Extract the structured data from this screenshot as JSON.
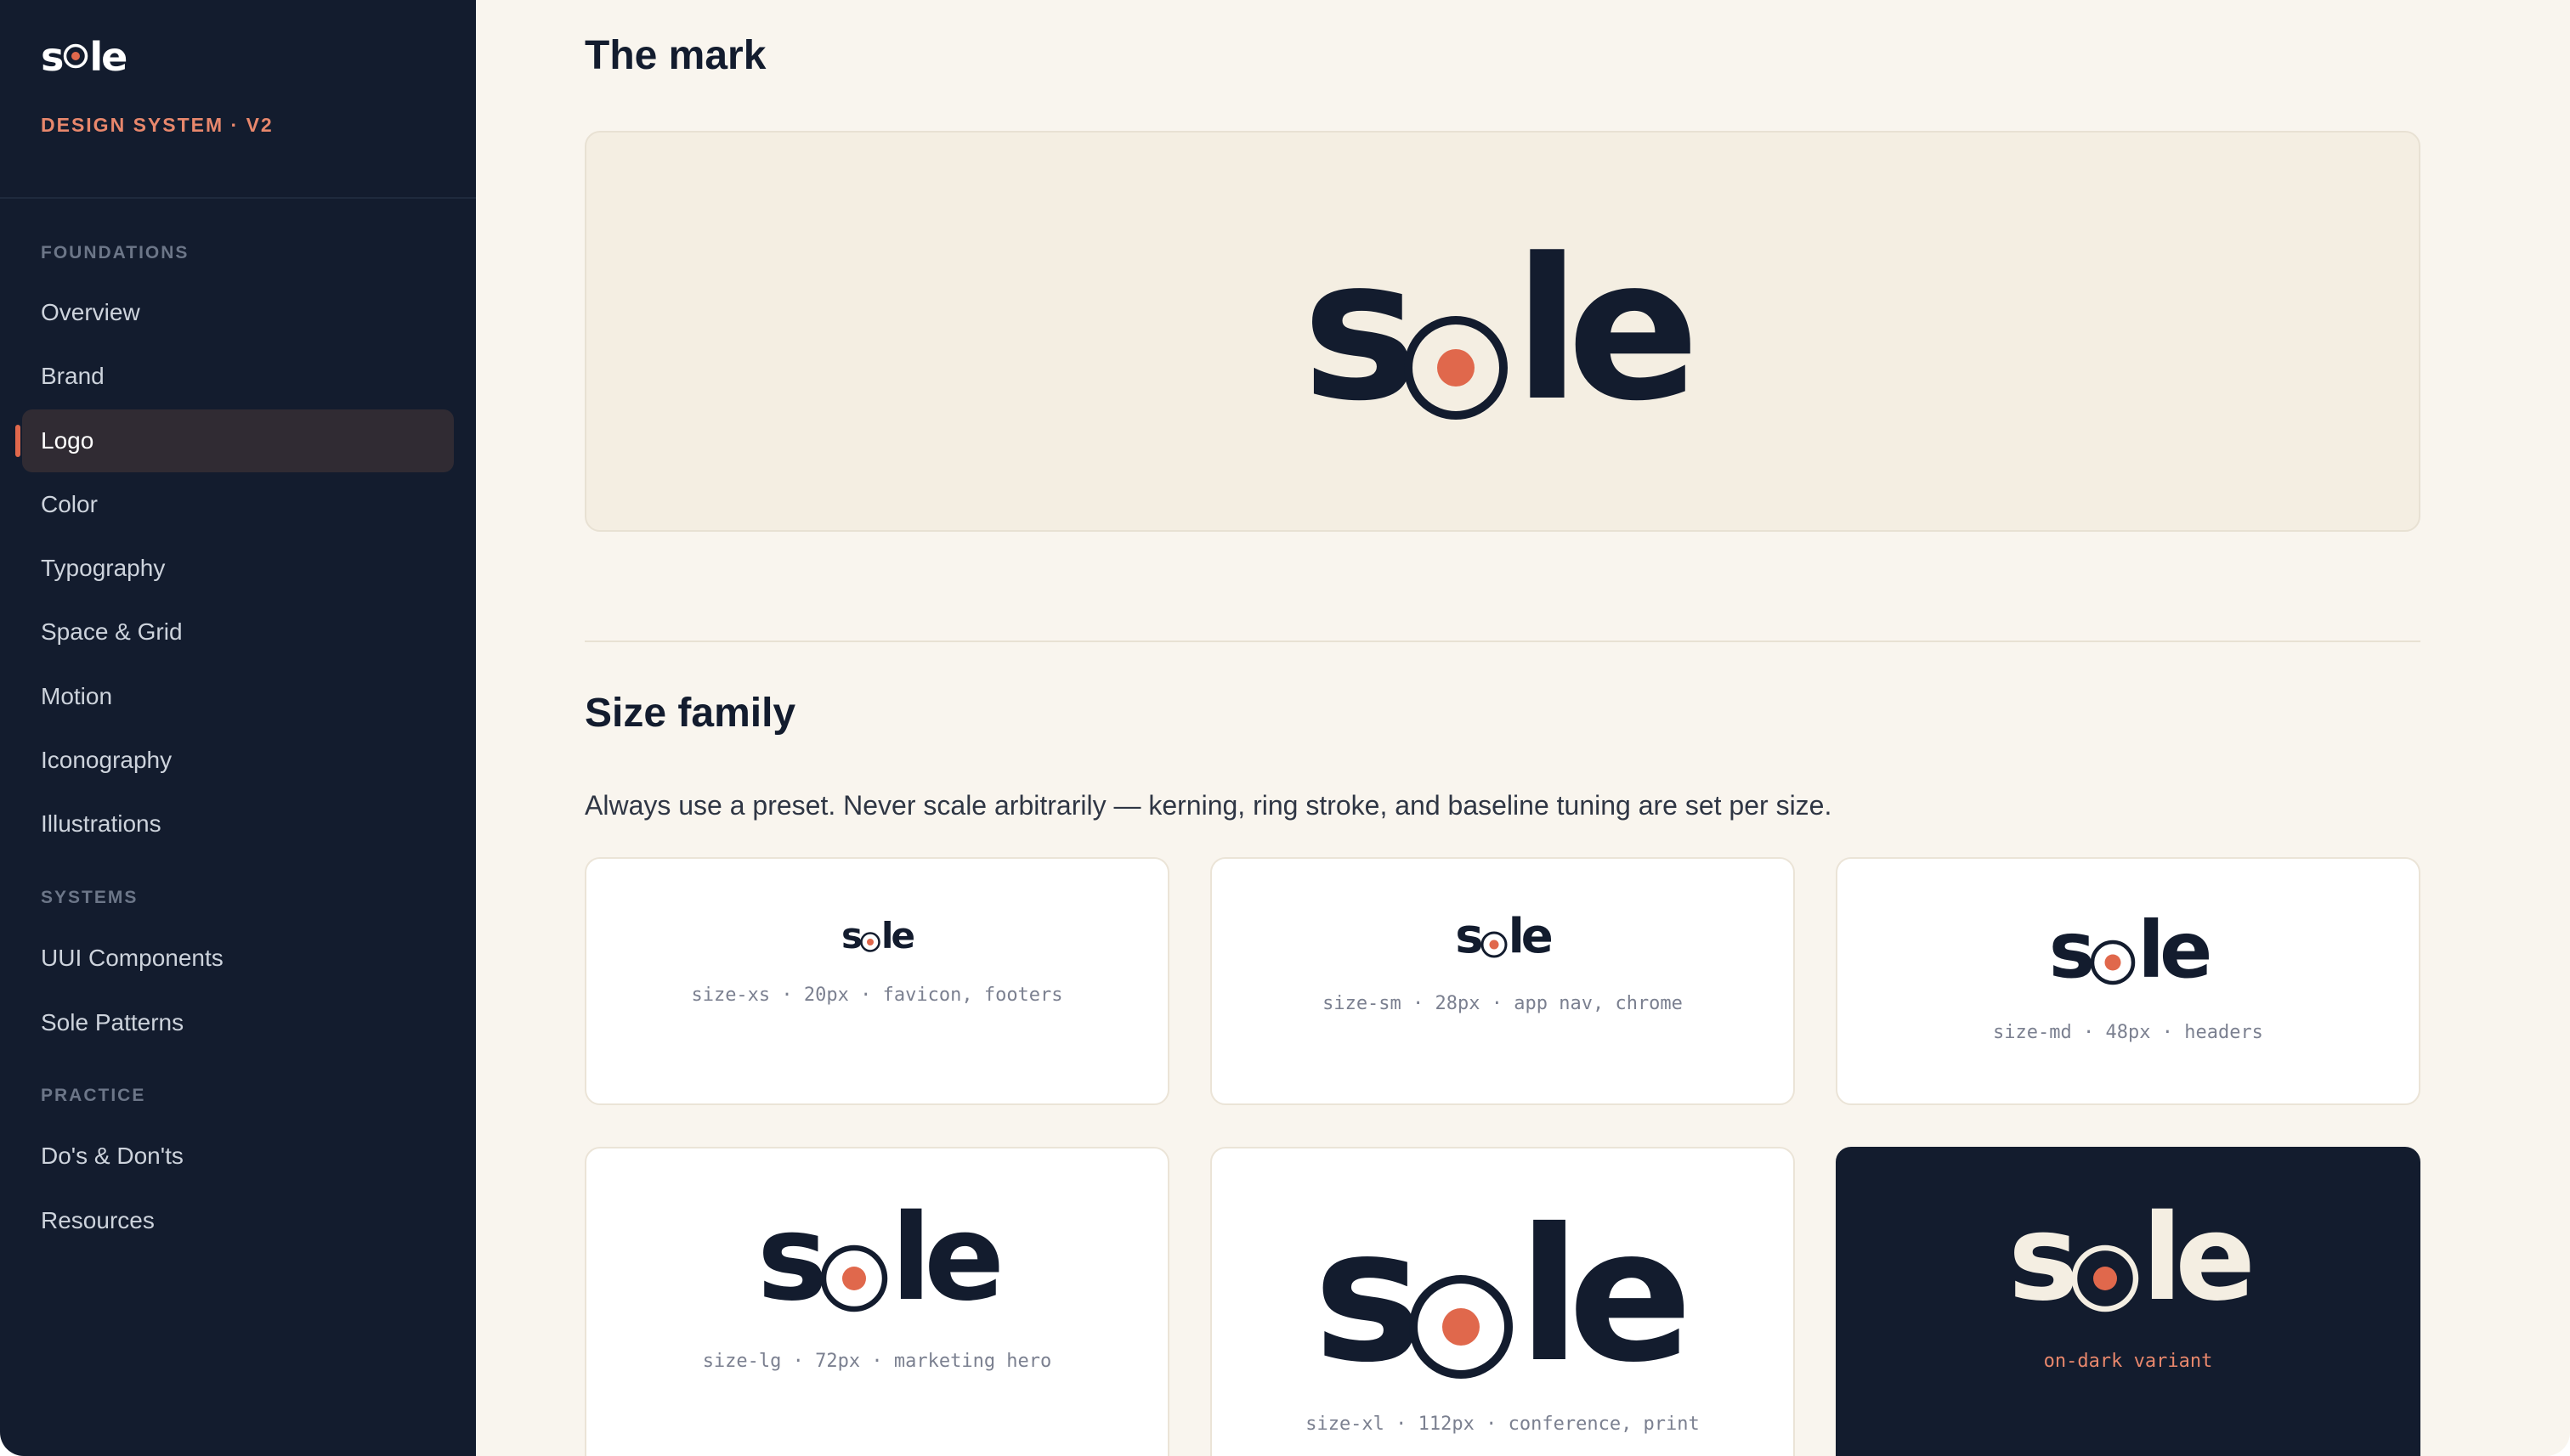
{
  "sidebar": {
    "logo": {
      "s": "s",
      "le": "le"
    },
    "subtitle": "DESIGN SYSTEM · V2",
    "groups": [
      {
        "label": "FOUNDATIONS"
      },
      {
        "label": "SYSTEMS"
      },
      {
        "label": "PRACTICE"
      }
    ],
    "items": [
      {
        "label": "Overview"
      },
      {
        "label": "Brand"
      },
      {
        "label": "Logo",
        "active": true
      },
      {
        "label": "Color"
      },
      {
        "label": "Typography"
      },
      {
        "label": "Space & Grid"
      },
      {
        "label": "Motion"
      },
      {
        "label": "Iconography"
      },
      {
        "label": "Illustrations"
      },
      {
        "label": "UUI Components"
      },
      {
        "label": "Sole Patterns"
      },
      {
        "label": "Do's & Don'ts"
      },
      {
        "label": "Resources"
      }
    ]
  },
  "main": {
    "mark_heading": "The mark",
    "size_heading": "Size family",
    "size_description": "Always use a preset. Never scale arbitrarily — kerning, ring stroke, and baseline tuning are set per size.",
    "wordmark": {
      "s": "s",
      "le": "le"
    },
    "cards": [
      {
        "caption": "size-xs · 20px · favicon, footers"
      },
      {
        "caption": "size-sm · 28px · app nav, chrome"
      },
      {
        "caption": "size-md · 48px · headers"
      },
      {
        "caption": "size-lg · 72px · marketing hero"
      },
      {
        "caption": "size-xl · 112px · conference, print"
      },
      {
        "caption": "on-dark variant"
      }
    ]
  },
  "colors": {
    "sidebar_bg": "#131c2e",
    "accent": "#e0684c",
    "accent_text": "#e8876c",
    "page_bg": "#f9f5ee",
    "hero_bg": "#f4eee2",
    "ink": "#131c2e"
  },
  "icons": {
    "ring_dot": "logo-ring-dot-icon"
  }
}
